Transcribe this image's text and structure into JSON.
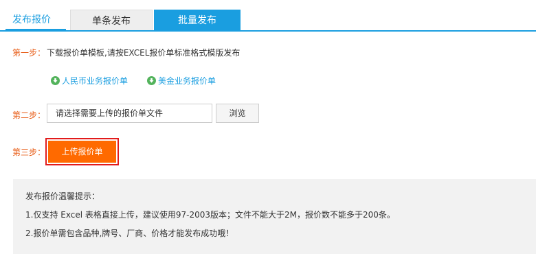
{
  "header": {
    "section_title": "发布报价",
    "tabs": [
      {
        "label": "单条发布",
        "active": false
      },
      {
        "label": "批量发布",
        "active": true
      }
    ]
  },
  "step1": {
    "label": "第一步：",
    "text": "下载报价单模板,请按EXCEL报价单标准格式模版发布",
    "downloads": [
      {
        "label": "人民币业务报价单",
        "icon": "download-circle-icon"
      },
      {
        "label": "美金业务报价单",
        "icon": "download-circle-icon"
      }
    ]
  },
  "step2": {
    "label": "第二步：",
    "file_placeholder": "请选择需要上传的报价单文件",
    "browse_label": "浏览"
  },
  "step3": {
    "label": "第三步：",
    "upload_label": "上传报价单"
  },
  "tips": {
    "title": "发布报价温馨提示：",
    "items": [
      "1.仅支持 Excel 表格直接上传，建议使用97-2003版本；文件不能大于2M，报价数不能多于200条。",
      "2.报价单需包含品种,牌号、厂商、价格才能发布成功哦！"
    ]
  },
  "colors": {
    "accent_blue": "#1a9ee0",
    "step_orange": "#e8601c",
    "upload_orange": "#ff6a00",
    "highlight_red": "#e21b1b",
    "download_green": "#53b35c"
  }
}
